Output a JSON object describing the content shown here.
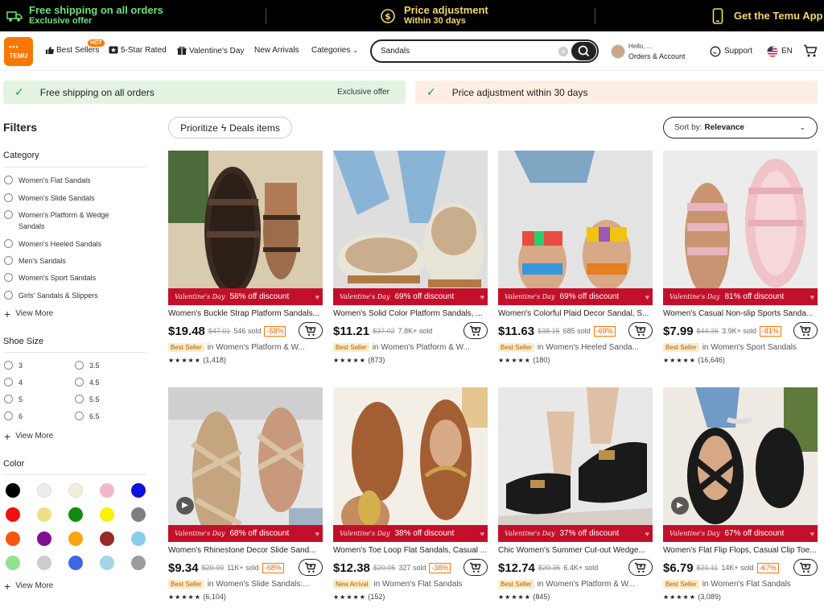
{
  "promo": {
    "shipping_title": "Free shipping on all orders",
    "shipping_sub": "Exclusive offer",
    "price_title": "Price adjustment",
    "price_sub": "Within 30 days",
    "app_label": "Get the Temu App"
  },
  "header": {
    "logo_text": "TEMU",
    "nav": {
      "best_sellers": "Best Sellers",
      "hot_badge": "HOT",
      "five_star": "5-Star Rated",
      "valentines": "Valentine's Day",
      "new_arrivals": "New Arrivals",
      "categories": "Categories"
    },
    "search_value": "Sandals",
    "account_hello": "Hello, ...",
    "account_label": "Orders & Account",
    "support": "Support",
    "language": "EN"
  },
  "banners": {
    "left_text": "Free shipping on all orders",
    "left_offer": "Exclusive offer",
    "right_text": "Price adjustment within 30 days"
  },
  "filters": {
    "title": "Filters",
    "category_title": "Category",
    "categories": [
      "Women's Flat Sandals",
      "Women's Slide Sandals",
      "Women's Platform & Wedge Sandals",
      "Women's Heeled Sandals",
      "Men's Sandals",
      "Women's Sport Sandals",
      "Girls' Sandals & Slippers"
    ],
    "view_more": "View More",
    "shoe_size_title": "Shoe Size",
    "sizes": [
      "3",
      "3.5",
      "4",
      "4.5",
      "5",
      "5.5",
      "6",
      "6.5"
    ],
    "color_title": "Color",
    "colors": [
      "#000000",
      "#ededed",
      "#f1efd6",
      "#f5b7c8",
      "#1010e0",
      "#f21010",
      "#ece08a",
      "#118a11",
      "#fbf108",
      "#7f7f7f",
      "#f6560e",
      "#800f98",
      "#f7a611",
      "#992828",
      "#88cdec",
      "#8fe28f",
      "#cccccc",
      "#3f66e2",
      "#a5d4e6",
      "#9b9b9b"
    ]
  },
  "toolbar": {
    "prioritize": "Prioritize",
    "deals": "Deals items",
    "sort_prefix": "Sort by:",
    "sort_value": "Relevance"
  },
  "products": [
    {
      "title": "Women's Buckle Strap Platform Sandals...",
      "price": "$19.48",
      "orig": "$47.01",
      "sold": "546 sold",
      "disc": "-58%",
      "ribbon": "58% off discount",
      "badge": "Best Seller",
      "category": "in Women's Platform & W...",
      "rating_count": "(1,418)",
      "video": false
    },
    {
      "title": "Women's Solid Color Platform Sandals, ...",
      "price": "$11.21",
      "orig": "$37.02",
      "sold": "7.8K+ sold",
      "disc": "",
      "ribbon": "69% off discount",
      "badge": "Best Seller",
      "category": "in Women's Platform & W...",
      "rating_count": "(873)",
      "video": false
    },
    {
      "title": "Women's Colorful Plaid Decor Sandal, S...",
      "price": "$11.63",
      "orig": "$38.15",
      "sold": "685 sold",
      "disc": "-69%",
      "ribbon": "69% off discount",
      "badge": "Best Seller",
      "category": "in Women's Heeled Sanda...",
      "rating_count": "(180)",
      "video": false
    },
    {
      "title": "Women's Casual Non-slip Sports Sanda...",
      "price": "$7.99",
      "orig": "$44.36",
      "sold": "3.9K+ sold",
      "disc": "-81%",
      "ribbon": "81% off discount",
      "badge": "Best Seller",
      "category": "in Women's Sport Sandals",
      "rating_count": "(16,646)",
      "video": false
    },
    {
      "title": "Women's Rhinestone Decor Slide Sand...",
      "price": "$9.34",
      "orig": "$29.99",
      "sold": "11K+ sold",
      "disc": "-68%",
      "ribbon": "68% off discount",
      "badge": "Best Seller",
      "category": "in Women's Slide Sandals:...",
      "rating_count": "(6,104)",
      "video": true
    },
    {
      "title": "Women's Toe Loop Flat Sandals, Casual ...",
      "price": "$12.38",
      "orig": "$20.05",
      "sold": "327 sold",
      "disc": "-38%",
      "ribbon": "38% off discount",
      "badge": "New Arrival",
      "category": "in Women's Flat Sandals",
      "rating_count": "(152)",
      "video": false
    },
    {
      "title": "Chic Women's Summer Cut-out Wedge...",
      "price": "$12.74",
      "orig": "$20.35",
      "sold": "6.4K+ sold",
      "disc": "",
      "ribbon": "37% off discount",
      "badge": "Best Seller",
      "category": "in Women's Platform & W...",
      "rating_count": "(845)",
      "video": false
    },
    {
      "title": "Women's Flat Flip Flops, Casual Clip Toe...",
      "price": "$6.79",
      "orig": "$21.11",
      "sold": "14K+ sold",
      "disc": "-67%",
      "ribbon": "67% off discount",
      "badge": "Best Seller",
      "category": "in Women's Flat Sandals",
      "rating_count": "(3,089)",
      "video": true
    }
  ],
  "ribbon_script": "Valentine's Day",
  "stars": "★★★★★"
}
